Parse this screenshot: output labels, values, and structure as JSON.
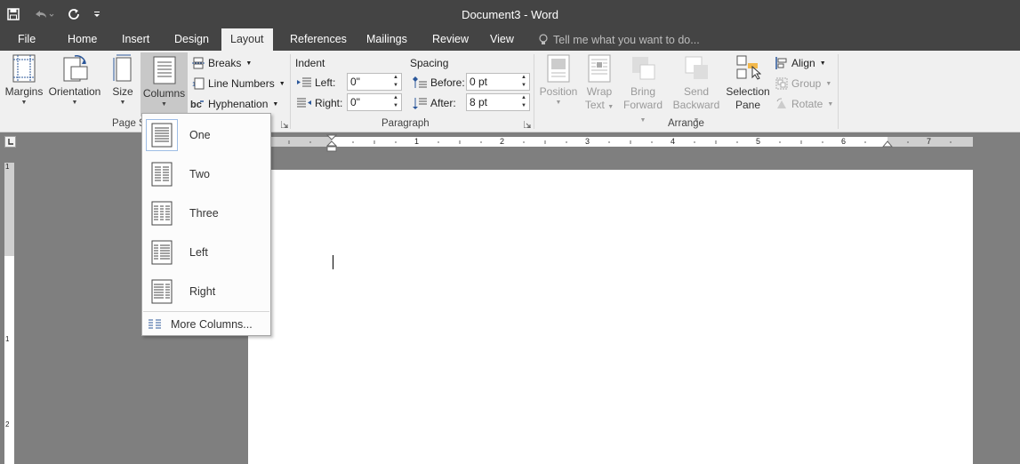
{
  "window": {
    "title": "Document3 - Word"
  },
  "tabs": [
    {
      "label": "File"
    },
    {
      "label": "Home"
    },
    {
      "label": "Insert"
    },
    {
      "label": "Design"
    },
    {
      "label": "Layout",
      "active": true
    },
    {
      "label": "References"
    },
    {
      "label": "Mailings"
    },
    {
      "label": "Review"
    },
    {
      "label": "View"
    }
  ],
  "tellme": {
    "text": "Tell me what you want to do..."
  },
  "page_setup": {
    "margins": "Margins",
    "orientation": "Orientation",
    "size": "Size",
    "columns": "Columns",
    "breaks": "Breaks",
    "line_numbers": "Line Numbers",
    "hyphenation": "Hyphenation",
    "group_label": "Page S"
  },
  "paragraph": {
    "indent_header": "Indent",
    "spacing_header": "Spacing",
    "left_label": "Left:",
    "left_value": "0\"",
    "right_label": "Right:",
    "right_value": "0\"",
    "before_label": "Before:",
    "before_value": "0 pt",
    "after_label": "After:",
    "after_value": "8 pt",
    "group_label": "Paragraph"
  },
  "arrange": {
    "position": "Position",
    "wrap_line1": "Wrap",
    "wrap_line2": "Text",
    "bring_line1": "Bring",
    "bring_line2": "Forward",
    "send_line1": "Send",
    "send_line2": "Backward",
    "sel_line1": "Selection",
    "sel_line2": "Pane",
    "align": "Align",
    "group": "Group",
    "rotate": "Rotate",
    "group_label": "Arrange"
  },
  "ruler_numbers": [
    "1",
    "2",
    "3",
    "4",
    "5",
    "6",
    "7"
  ],
  "vruler_numbers": [
    "1",
    "1",
    "2"
  ],
  "columns_menu": {
    "items": [
      {
        "label": "One",
        "selected": true
      },
      {
        "label": "Two"
      },
      {
        "label": "Three"
      },
      {
        "label": "Left"
      },
      {
        "label": "Right"
      }
    ],
    "more": "More Columns..."
  },
  "colors": {
    "titlebar": "#444444",
    "ribbon": "#f0f0f0",
    "workspace": "#7f7f7f",
    "accent": "#2b579a"
  }
}
